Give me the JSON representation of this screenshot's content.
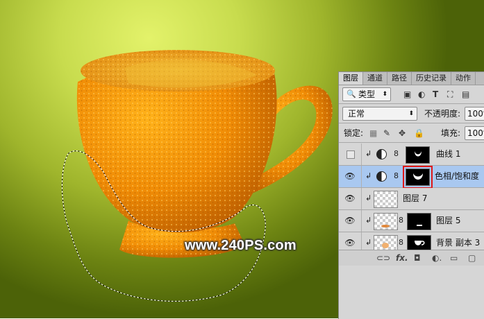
{
  "watermark": "www.240PS.com",
  "panel": {
    "tabs": [
      "图层",
      "通道",
      "路径",
      "历史记录",
      "动作"
    ],
    "filter_kind": "类型",
    "blend_mode": "正常",
    "opacity_label": "不透明度:",
    "opacity_value": "100%",
    "lock_label": "锁定:",
    "fill_label": "填充:",
    "fill_value": "100%",
    "layers": [
      {
        "name": "曲线 1",
        "visible": false,
        "selected": false
      },
      {
        "name": "色相/饱和度",
        "visible": true,
        "selected": true
      },
      {
        "name": "图层 7",
        "visible": true,
        "selected": false
      },
      {
        "name": "图层 5",
        "visible": true,
        "selected": false
      },
      {
        "name": "背景 副本 3",
        "visible": true,
        "selected": false
      }
    ],
    "icons": {
      "eye": "eye-icon",
      "filter_icons": [
        "image-filter-icon",
        "adjustment-filter-icon",
        "type-filter-icon",
        "shape-filter-icon",
        "smart-object-filter-icon"
      ],
      "lock_icons": [
        "lock-transparent-icon",
        "lock-brush-icon",
        "lock-move-icon",
        "lock-all-icon"
      ],
      "footer_icons": [
        "link-icon",
        "fx-icon",
        "add-mask-icon",
        "new-adjustment-icon",
        "new-group-icon",
        "new-layer-icon"
      ]
    }
  }
}
